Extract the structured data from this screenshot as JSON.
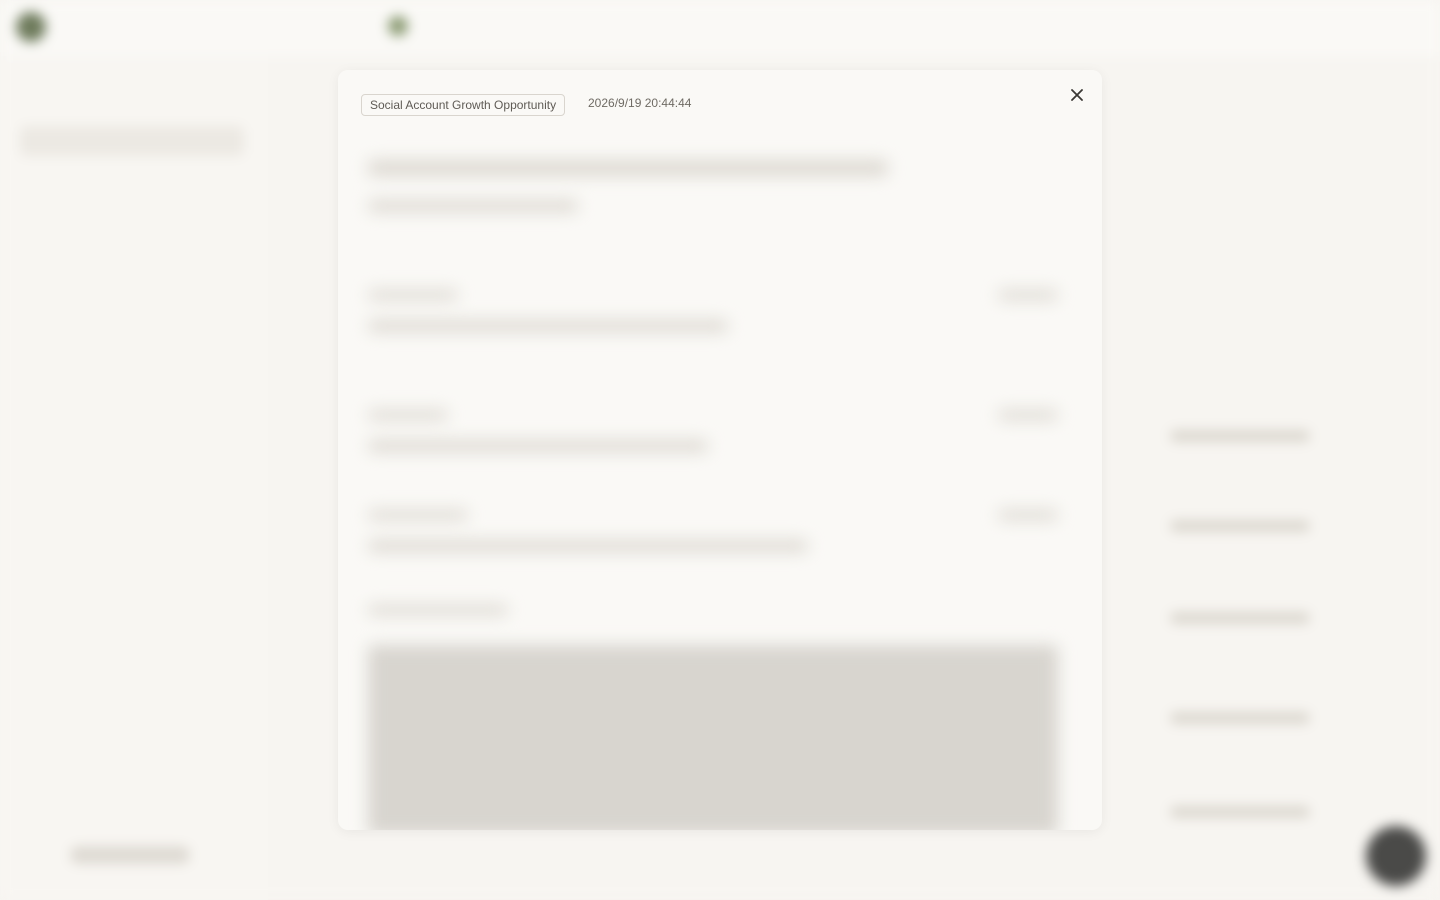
{
  "modal": {
    "tag": "Social Account Growth Opportunity",
    "timestamp": "2026/9/19 20:44:44",
    "close_icon": "close-icon"
  }
}
